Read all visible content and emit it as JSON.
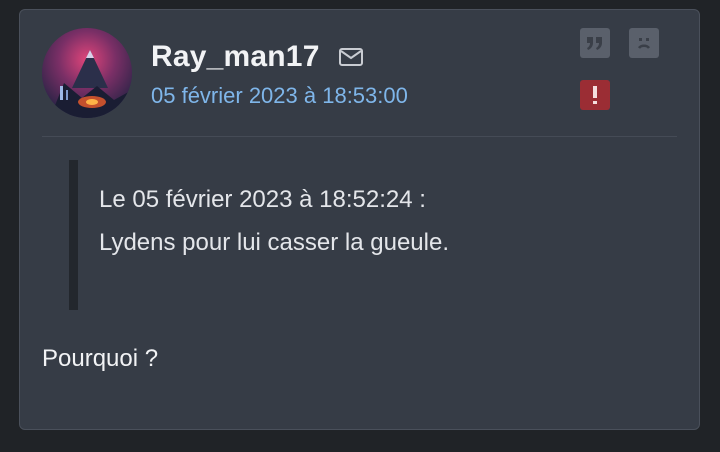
{
  "post": {
    "author": "Ray_man17",
    "date": "05 février 2023 à 18:53:00",
    "quote": {
      "header": "Le 05 février 2023 à 18:52:24 :",
      "text": "Lydens pour lui casser la gueule."
    },
    "message": "Pourquoi ?"
  },
  "actions": {
    "quote_icon": "quote-icon",
    "sad_icon": "sad-face-icon",
    "report_icon": "exclamation-icon",
    "mail_icon": "envelope-icon"
  },
  "colors": {
    "background": "#202327",
    "card": "#363c46",
    "date_link": "#7fb6ea",
    "report": "#9b2d34",
    "button": "#5a606b"
  }
}
